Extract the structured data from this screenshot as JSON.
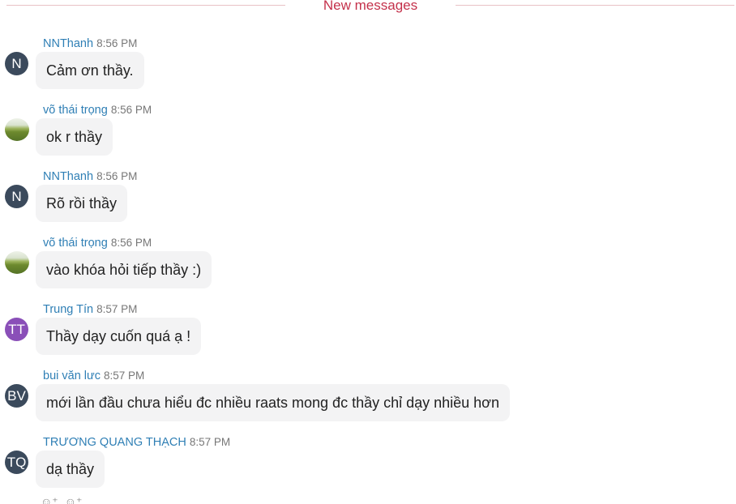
{
  "divider": {
    "label": "New messages"
  },
  "messages": [
    {
      "initials": "N",
      "name": "NNThanh",
      "time": "8:56 PM",
      "text": "Cảm ơn thầy."
    },
    {
      "initials": "",
      "name": "võ thái trọng",
      "time": "8:56 PM",
      "text": "ok r thầy"
    },
    {
      "initials": "N",
      "name": "NNThanh",
      "time": "8:56 PM",
      "text": "Rõ rồi thầy"
    },
    {
      "initials": "",
      "name": "võ thái trọng",
      "time": "8:56 PM",
      "text": "vào khóa hỏi tiếp thầy :)"
    },
    {
      "initials": "TT",
      "name": "Trung Tín",
      "time": "8:57 PM",
      "text": "Thầy dạy cuốn quá ạ !"
    },
    {
      "initials": "BV",
      "name": "bui văn lưc",
      "time": "8:57 PM",
      "text": "mới lần đầu chưa hiểu đc nhiều raats mong đc thầy chỉ dạy nhiều hơn"
    },
    {
      "initials": "TQ",
      "name": "TRƯƠNG QUANG THẠCH",
      "time": "8:57 PM",
      "text": "dạ thầy"
    }
  ],
  "colors": {
    "divider_label": "#c4314b",
    "divider_line": "#e8c2c6",
    "sender_name": "#2f7fb5",
    "bubble_bg": "#f3f3f4",
    "avatar_dark": "#3b4a5c",
    "avatar_purple": "#8a4fb8"
  },
  "icons": {
    "reactions": [
      "add-reaction-icon",
      "add-emoji-icon"
    ]
  }
}
